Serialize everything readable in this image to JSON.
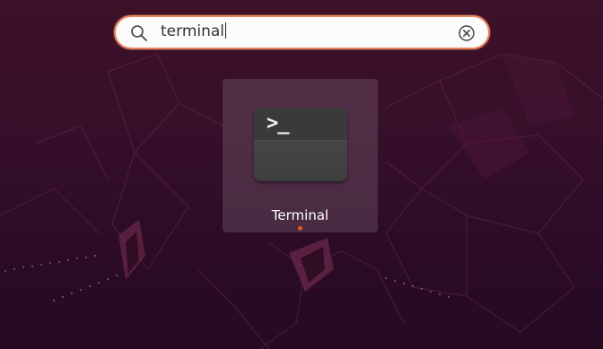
{
  "search": {
    "value": "terminal",
    "icon": "search-icon",
    "clear_icon": "clear-icon",
    "border_color": "#e9855f"
  },
  "results": [
    {
      "label": "Terminal",
      "icon": "terminal-icon",
      "icon_glyph": ">_",
      "running": true,
      "indicator_color": "#e95420"
    }
  ],
  "theme": {
    "background": "#3a0f2a",
    "tile_highlight": "rgba(255,255,255,0.13)"
  }
}
